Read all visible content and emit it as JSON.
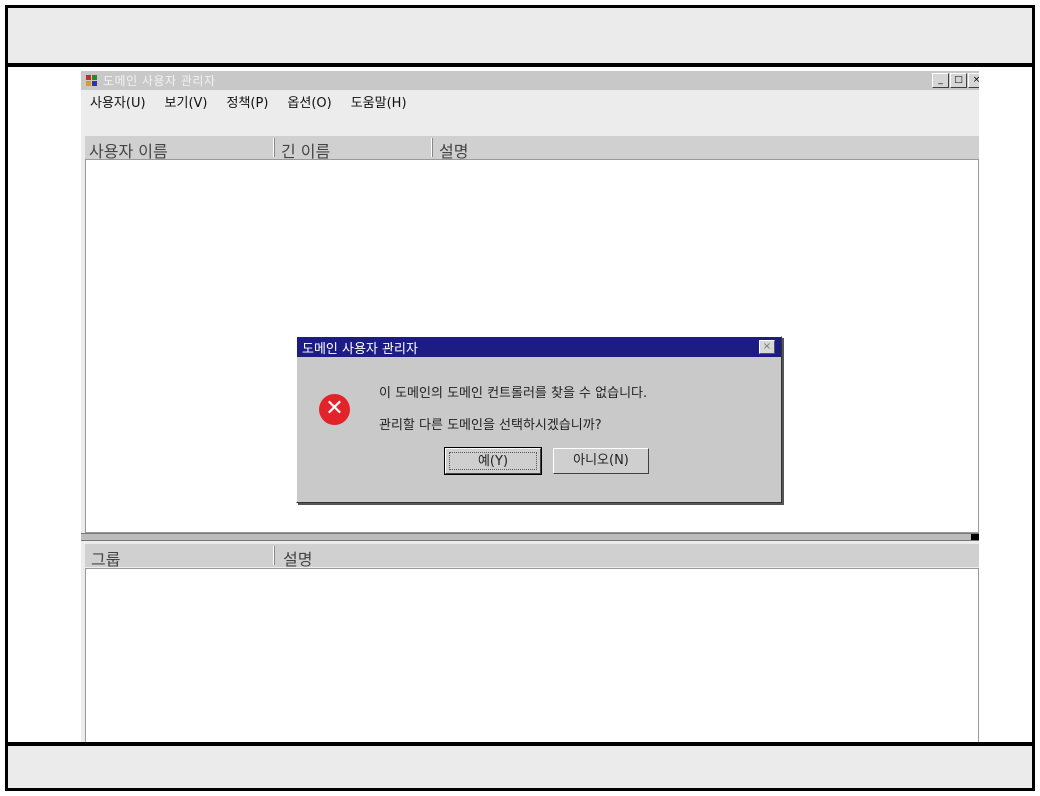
{
  "window": {
    "title": "도메인 사용자 관리자",
    "menu": [
      "사용자(U)",
      "보기(V)",
      "정책(P)",
      "옵션(O)",
      "도움말(H)"
    ],
    "sysbuttons": [
      "_",
      "□",
      "×"
    ]
  },
  "user_list": {
    "columns": [
      "사용자 이름",
      "긴 이름",
      "설명"
    ]
  },
  "group_list": {
    "columns": [
      "그룹",
      "설명"
    ]
  },
  "dialog": {
    "title": "도메인 사용자 관리자",
    "close": "×",
    "icon": "error-icon",
    "message_line1": "이 도메인의 도메인 컨트롤러를 찾을 수 없습니다.",
    "message_line2": "관리할 다른 도메인을 선택하시겠습니까?",
    "yes_label": "예(Y)",
    "no_label": "아니오(N)"
  },
  "colors": {
    "dialog_titlebar": "#1c1c84",
    "error_icon": "#e3232a"
  }
}
